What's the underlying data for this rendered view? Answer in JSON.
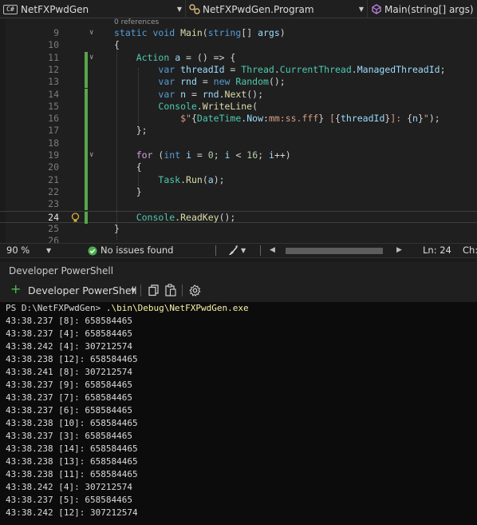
{
  "nav": {
    "project_badge": "C#",
    "project": "NetFXPwdGen",
    "class": "NetFXPwdGen.Program",
    "member": "Main(string[] args)"
  },
  "editor": {
    "references_hint": "0 references",
    "lines": [
      {
        "n": "9",
        "segs": [
          [
            "kw",
            "static void "
          ],
          [
            "fn",
            "Main"
          ],
          [
            "pl",
            "("
          ],
          [
            "kw",
            "string"
          ],
          [
            "pl",
            "[] "
          ],
          [
            "lc",
            "args"
          ],
          [
            "pl",
            ")"
          ]
        ]
      },
      {
        "n": "10",
        "segs": [
          [
            "pl",
            "{"
          ]
        ]
      },
      {
        "n": "11",
        "segs": [
          [
            "pl",
            "    "
          ],
          [
            "ty",
            "Action"
          ],
          [
            "pl",
            " "
          ],
          [
            "lc",
            "a"
          ],
          [
            "pl",
            " = () => {"
          ]
        ]
      },
      {
        "n": "12",
        "segs": [
          [
            "pl",
            "        "
          ],
          [
            "kw",
            "var"
          ],
          [
            "pl",
            " "
          ],
          [
            "lc",
            "threadId"
          ],
          [
            "pl",
            " = "
          ],
          [
            "ty",
            "Thread"
          ],
          [
            "pl",
            "."
          ],
          [
            "ty",
            "CurrentThread"
          ],
          [
            "pl",
            "."
          ],
          [
            "lc",
            "ManagedThreadId"
          ],
          [
            "pl",
            ";"
          ]
        ]
      },
      {
        "n": "13",
        "segs": [
          [
            "pl",
            "        "
          ],
          [
            "kw",
            "var"
          ],
          [
            "pl",
            " "
          ],
          [
            "lc",
            "rnd"
          ],
          [
            "pl",
            " = "
          ],
          [
            "kw",
            "new"
          ],
          [
            "pl",
            " "
          ],
          [
            "ty",
            "Random"
          ],
          [
            "pl",
            "();"
          ]
        ]
      },
      {
        "n": "14",
        "segs": [
          [
            "pl",
            "        "
          ],
          [
            "kw",
            "var"
          ],
          [
            "pl",
            " "
          ],
          [
            "lc",
            "n"
          ],
          [
            "pl",
            " = "
          ],
          [
            "lc",
            "rnd"
          ],
          [
            "pl",
            "."
          ],
          [
            "fn",
            "Next"
          ],
          [
            "pl",
            "();"
          ]
        ]
      },
      {
        "n": "15",
        "segs": [
          [
            "pl",
            "        "
          ],
          [
            "ty",
            "Console"
          ],
          [
            "pl",
            "."
          ],
          [
            "fn",
            "WriteLine"
          ],
          [
            "pl",
            "("
          ]
        ]
      },
      {
        "n": "16",
        "segs": [
          [
            "pl",
            "            "
          ],
          [
            "st",
            "$\""
          ],
          [
            "pl",
            "{"
          ],
          [
            "ty",
            "DateTime"
          ],
          [
            "pl",
            "."
          ],
          [
            "lc",
            "Now"
          ],
          [
            "pl",
            ":"
          ],
          [
            "st",
            "mm:ss.fff"
          ],
          [
            "pl",
            "}"
          ],
          [
            "st",
            " ["
          ],
          [
            "pl",
            "{"
          ],
          [
            "lc",
            "threadId"
          ],
          [
            "pl",
            "}"
          ],
          [
            "st",
            "]: "
          ],
          [
            "pl",
            "{"
          ],
          [
            "lc",
            "n"
          ],
          [
            "pl",
            "}"
          ],
          [
            "st",
            "\""
          ],
          [
            "pl",
            ");"
          ]
        ]
      },
      {
        "n": "17",
        "segs": [
          [
            "pl",
            "    };"
          ]
        ]
      },
      {
        "n": "18",
        "segs": []
      },
      {
        "n": "19",
        "segs": [
          [
            "pl",
            "    "
          ],
          [
            "ctl",
            "for"
          ],
          [
            "pl",
            " ("
          ],
          [
            "kw",
            "int"
          ],
          [
            "pl",
            " "
          ],
          [
            "lc",
            "i"
          ],
          [
            "pl",
            " = "
          ],
          [
            "nu",
            "0"
          ],
          [
            "pl",
            "; "
          ],
          [
            "lc",
            "i"
          ],
          [
            "pl",
            " < "
          ],
          [
            "nu",
            "16"
          ],
          [
            "pl",
            "; "
          ],
          [
            "lc",
            "i"
          ],
          [
            "pl",
            "++)"
          ]
        ]
      },
      {
        "n": "20",
        "segs": [
          [
            "pl",
            "    {"
          ]
        ]
      },
      {
        "n": "21",
        "segs": [
          [
            "pl",
            "        "
          ],
          [
            "ty",
            "Task"
          ],
          [
            "pl",
            "."
          ],
          [
            "fn",
            "Run"
          ],
          [
            "pl",
            "("
          ],
          [
            "lc",
            "a"
          ],
          [
            "pl",
            ");"
          ]
        ]
      },
      {
        "n": "22",
        "segs": [
          [
            "pl",
            "    }"
          ]
        ]
      },
      {
        "n": "23",
        "segs": []
      },
      {
        "n": "24",
        "segs": [
          [
            "pl",
            "    "
          ],
          [
            "ty",
            "Console"
          ],
          [
            "pl",
            "."
          ],
          [
            "fn",
            "ReadKey"
          ],
          [
            "pl",
            "();"
          ]
        ]
      },
      {
        "n": "25",
        "segs": [
          [
            "pl",
            "}"
          ]
        ]
      },
      {
        "n": "26",
        "segs": []
      }
    ]
  },
  "status": {
    "zoom": "90 %",
    "issues": "No issues found",
    "line": "Ln: 24",
    "col": "Ch:"
  },
  "terminal_panel": {
    "title": "Developer PowerShell",
    "new_terminal_label": "Developer PowerShell",
    "prompt": "PS D:\\NetFXPwdGen>",
    "command": ".\\bin\\Debug\\NetFXPwdGen.exe",
    "output": [
      "43:38.237 [8]: 658584465",
      "43:38.237 [4]: 658584465",
      "43:38.242 [4]: 307212574",
      "43:38.238 [12]: 658584465",
      "43:38.241 [8]: 307212574",
      "43:38.237 [9]: 658584465",
      "43:38.237 [7]: 658584465",
      "43:38.237 [6]: 658584465",
      "43:38.238 [10]: 658584465",
      "43:38.237 [3]: 658584465",
      "43:38.238 [14]: 658584465",
      "43:38.238 [13]: 658584465",
      "43:38.238 [11]: 658584465",
      "43:38.242 [4]: 307212574",
      "43:38.237 [5]: 658584465",
      "43:38.242 [12]: 307212574"
    ]
  }
}
